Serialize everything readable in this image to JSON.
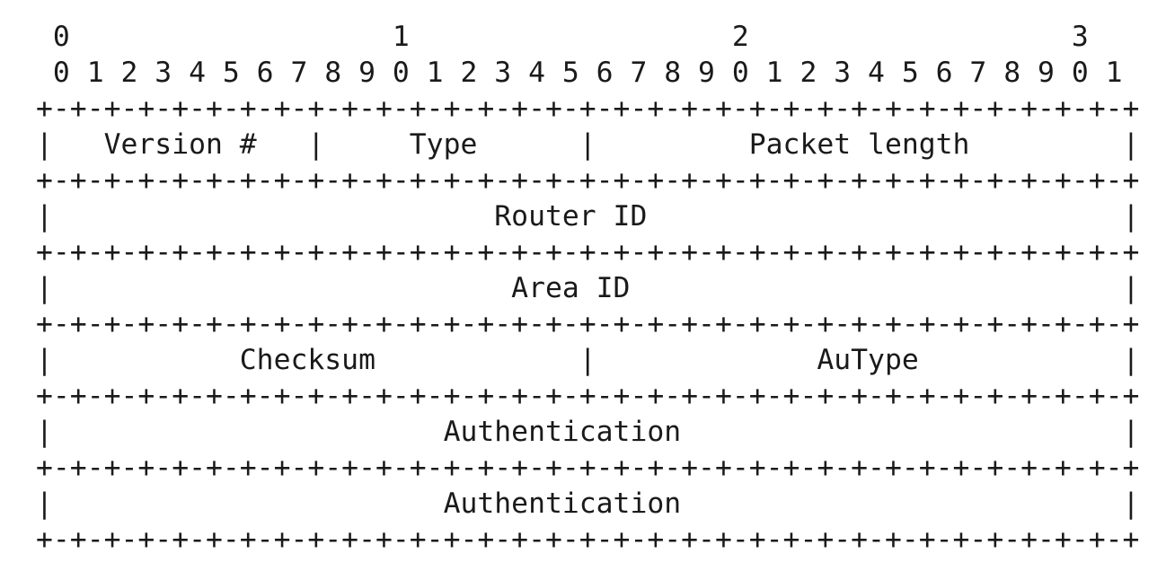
{
  "ruler": {
    "tens": " 0                   1                   2                   3",
    "units": " 0 1 2 3 4 5 6 7 8 9 0 1 2 3 4 5 6 7 8 9 0 1 2 3 4 5 6 7 8 9 0 1"
  },
  "border": "+-+-+-+-+-+-+-+-+-+-+-+-+-+-+-+-+-+-+-+-+-+-+-+-+-+-+-+-+-+-+-+-+",
  "rows": [
    "|   Version #   |     Type      |         Packet length         |",
    "|                          Router ID                            |",
    "|                           Area ID                             |",
    "|           Checksum            |             AuType            |",
    "|                       Authentication                          |",
    "|                       Authentication                          |"
  ]
}
